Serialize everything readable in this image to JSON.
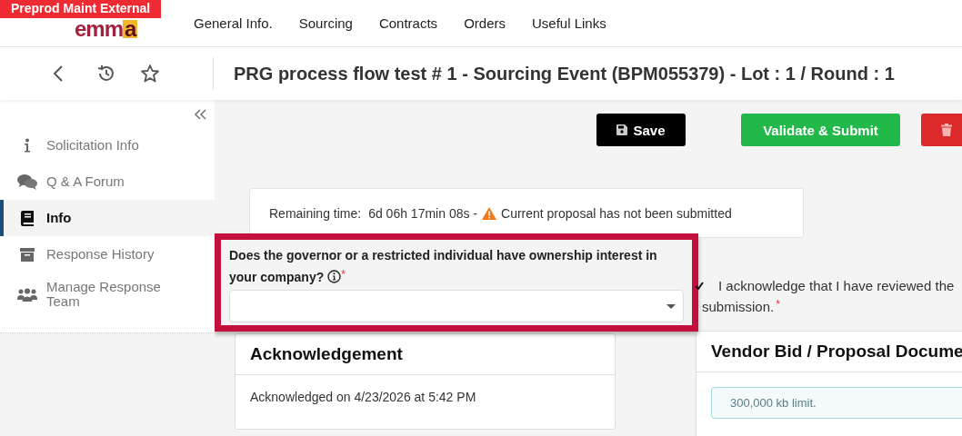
{
  "env_badge": "Preprod Maint External",
  "logo": {
    "text": "emm",
    "accent": "a"
  },
  "nav": [
    {
      "label": "General Info."
    },
    {
      "label": "Sourcing"
    },
    {
      "label": "Contracts"
    },
    {
      "label": "Orders"
    },
    {
      "label": "Useful Links"
    }
  ],
  "page_title": "PRG process flow test # 1 - Sourcing Event (BPM055379) - Lot : 1 / Round : 1",
  "toolbar": {
    "save": "Save",
    "submit": "Validate & Submit"
  },
  "sidebar": {
    "items": [
      {
        "label": "Solicitation Info",
        "kind": "info",
        "selected": false
      },
      {
        "label": "Q & A Forum",
        "kind": "chat",
        "selected": false
      },
      {
        "label": "Info",
        "kind": "book",
        "selected": true
      },
      {
        "label": "Response History",
        "kind": "archive",
        "selected": false
      },
      {
        "label": "Manage Response Team",
        "kind": "team",
        "selected": false
      }
    ]
  },
  "remaining": {
    "label": "Remaining time:",
    "value": "6d 06h 17min 08s -",
    "warning": "Current proposal has not been submitted"
  },
  "question": {
    "line_1": "Does the governor or a restricted individual have ownership interest in",
    "line_2": "your company?",
    "required_mark": "*"
  },
  "acknowledge_check": {
    "checked": true,
    "line_1": "I acknowledge that I have reviewed the",
    "line_2": "submission.",
    "required_mark": "*"
  },
  "ack_card": {
    "title": "Acknowledgement",
    "text": "Acknowledged on 4/23/2026 at 5:42 PM"
  },
  "docs_card": {
    "title": "Vendor Bid / Proposal Docume",
    "note": "300,000 kb limit."
  }
}
